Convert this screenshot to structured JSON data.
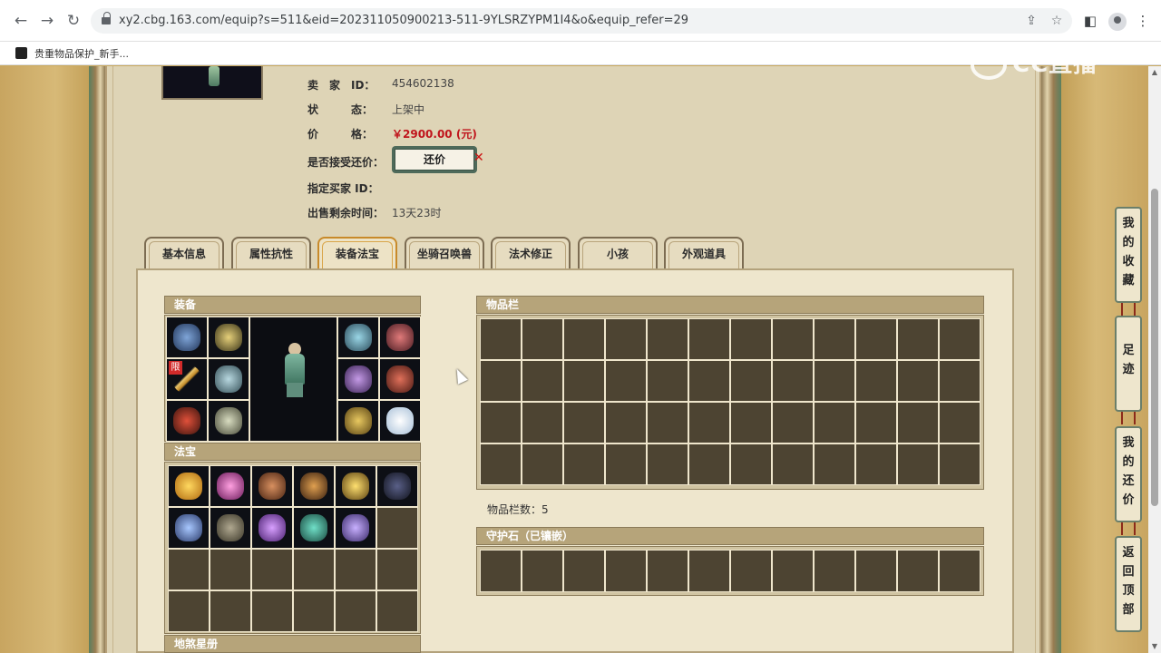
{
  "browser": {
    "url": "xy2.cbg.163.com/equip?s=511&eid=202311050900213-511-9YLSRZYPM1I4&o&equip_refer=29",
    "bookmark": "贵重物品保护_新手..."
  },
  "watermark": "CC直播",
  "seller": {
    "id_label": "卖　家　ID：",
    "id_value": "454602138",
    "status_label": "状　　　态：",
    "status_value": "上架中",
    "price_label": "价　　　格：",
    "price_value": "￥2900.00 (元)",
    "counter_label": "是否接受还价：",
    "counter_button": "还价",
    "buyer_label": "指定买家 ID：",
    "remaining_label": "出售剩余时间：",
    "remaining_value": "13天23时"
  },
  "tabs": [
    "基本信息",
    "属性抗性",
    "装备法宝",
    "坐骑召唤兽",
    "法术修正",
    "小孩",
    "外观道具"
  ],
  "active_tab": "装备法宝",
  "sections": {
    "equipment": "装备",
    "treasure": "法宝",
    "inventory": "物品栏",
    "inventory_count": "物品栏数：5",
    "guard_stone": "守护石（已镶嵌）",
    "star_book": "地煞星册"
  },
  "equipment_badge": "限",
  "side_nav": [
    "我的收藏",
    "足迹",
    "我的还价",
    "返回顶部"
  ],
  "colors": {
    "price_red": "#c0141c",
    "panel_bg": "#eee6cd",
    "cell_dark": "#4d4432",
    "section_bar": "#b6a47a"
  }
}
